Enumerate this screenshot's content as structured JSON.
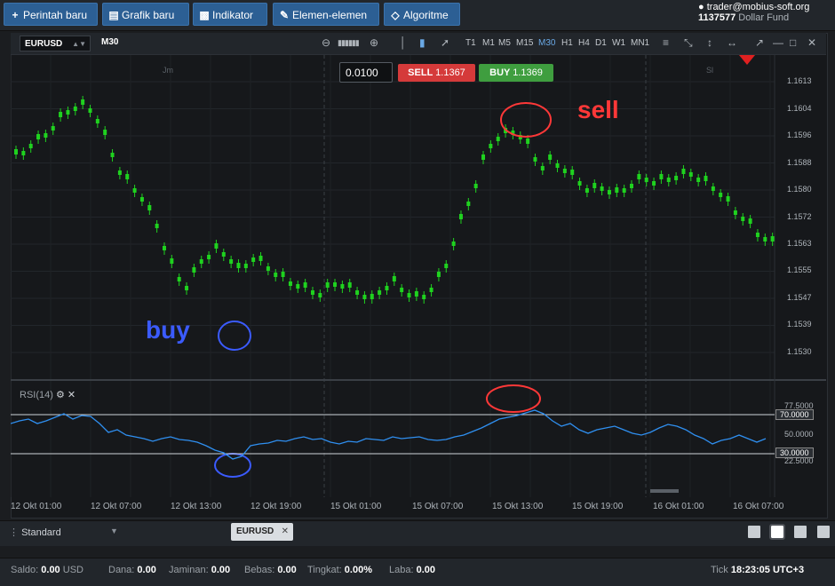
{
  "toolbar": {
    "new_order": "Perintah baru",
    "new_chart": "Grafik baru",
    "indicator": "Indikator",
    "elements": "Elemen-elemen",
    "algorithm": "Algoritme"
  },
  "account": {
    "email": "trader@mobius-soft.org",
    "number": "1137577",
    "fund": "Dollar Fund"
  },
  "chart": {
    "symbol": "EURUSD",
    "timeframe": "M30",
    "timeframes": [
      "T1",
      "M1",
      "M5",
      "M15",
      "M30",
      "H1",
      "H4",
      "D1",
      "W1",
      "MN1"
    ],
    "active_timeframe": "M30",
    "volume": "0.0100",
    "sell_label": "SELL",
    "sell_price": "1.1367",
    "buy_label": "BUY",
    "buy_price": "1.1369",
    "session_labels": [
      "Jm",
      "Sl"
    ],
    "annotation_sell": "sell",
    "annotation_buy": "buy",
    "rsi_label": "RSI(14)",
    "price_labels": [
      "1.1613",
      "1.1604",
      "1.1596",
      "1.1588",
      "1.1580",
      "1.1572",
      "1.1563",
      "1.1555",
      "1.1547",
      "1.1539",
      "1.1530"
    ],
    "rsi_levels": [
      "77.5000",
      "70.0000",
      "50.0000",
      "30.0000",
      "22.5000"
    ],
    "time_labels": [
      "12 Okt 01:00",
      "12 Okt 07:00",
      "12 Okt 13:00",
      "12 Okt 19:00",
      "15 Okt 01:00",
      "15 Okt 07:00",
      "15 Okt 13:00",
      "15 Okt 19:00",
      "16 Okt 01:00",
      "16 Okt 07:00"
    ]
  },
  "colors": {
    "bull": "#1fd21f",
    "bear": "#1fd21f",
    "rsi_line": "#2f8ff0",
    "annotation_red": "#ff3838",
    "annotation_blue": "#3b5bff",
    "accent": "#2c5f94"
  },
  "tabs": {
    "workspace": "Standard",
    "chart_tab": "EURUSD"
  },
  "status": {
    "balance_label": "Saldo:",
    "balance_value": "0.00",
    "balance_currency": "USD",
    "funds_label": "Dana:",
    "funds_value": "0.00",
    "margin_label": "Jaminan:",
    "margin_value": "0.00",
    "free_label": "Bebas:",
    "free_value": "0.00",
    "level_label": "Tingkat:",
    "level_value": "0.00%",
    "profit_label": "Laba:",
    "profit_value": "0.00",
    "tick_label": "Tick",
    "time": "18:23:05",
    "timezone": "UTC+3"
  },
  "icons": {
    "new_order": "plus-icon",
    "new_chart": "chart-icon",
    "indicator": "bar-chart-icon",
    "elements": "pen-icon",
    "algorithm": "diamond-icon",
    "user": "user-icon",
    "gear": "gear-icon",
    "close": "close-icon"
  }
}
